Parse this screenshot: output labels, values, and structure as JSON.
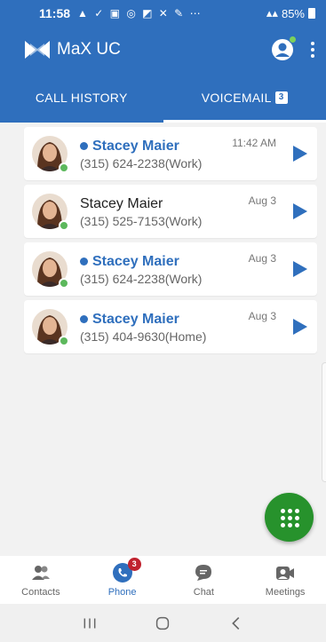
{
  "status_bar": {
    "time": "11:58",
    "notification_icons": "▲ ✓ ▣ ◎ ◩ ✕ ✎ ⋯",
    "signal": "4G LTE",
    "battery": "85%"
  },
  "app_bar": {
    "title": "MaX UC"
  },
  "tabs": [
    {
      "label": "CALL HISTORY",
      "active": false
    },
    {
      "label": "VOICEMAIL",
      "badge": "3",
      "active": true
    }
  ],
  "voicemails": [
    {
      "name": "Stacey Maier",
      "number": "(315) 624-2238(Work)",
      "time": "11:42 AM",
      "unread": true
    },
    {
      "name": "Stacey Maier",
      "number": "(315) 525-7153(Work)",
      "time": "Aug 3",
      "unread": false
    },
    {
      "name": "Stacey Maier",
      "number": "(315) 624-2238(Work)",
      "time": "Aug 3",
      "unread": true
    },
    {
      "name": "Stacey Maier",
      "number": "(315) 404-9630(Home)",
      "time": "Aug 3",
      "unread": true
    }
  ],
  "bottom_nav": [
    {
      "label": "Contacts",
      "icon": "contacts-icon",
      "active": false
    },
    {
      "label": "Phone",
      "icon": "phone-icon",
      "active": true,
      "badge": "3"
    },
    {
      "label": "Chat",
      "icon": "chat-icon",
      "active": false
    },
    {
      "label": "Meetings",
      "icon": "meetings-icon",
      "active": false
    }
  ],
  "colors": {
    "primary": "#2f6fbd",
    "fab": "#27922c",
    "presence": "#5cb85c",
    "badge": "#c0222e"
  }
}
